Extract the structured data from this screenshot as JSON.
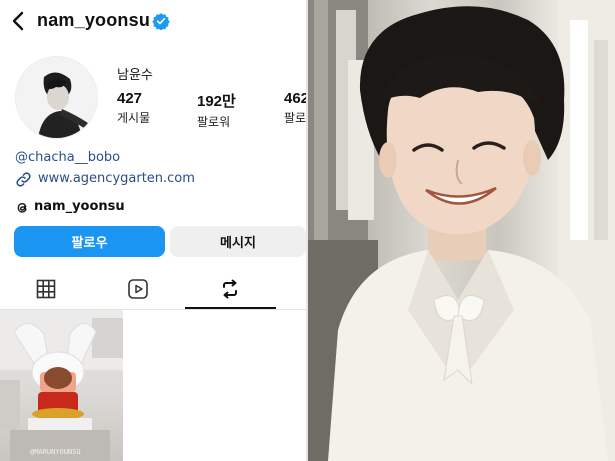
{
  "header": {
    "username": "nam_yoonsu"
  },
  "profile": {
    "display_name": "남윤수",
    "stats": [
      {
        "value": "427",
        "label": "게시물"
      },
      {
        "value": "192만",
        "label": "팔로워"
      },
      {
        "value": "462",
        "label": "팔로"
      }
    ],
    "mention": "@chacha__bobo",
    "website": "www.agencygarten.com",
    "threads_handle": "nam_yoonsu"
  },
  "actions": {
    "follow_label": "팔로우",
    "message_label": "메시지"
  },
  "tabs": [
    {
      "icon": "grid-icon",
      "active": false
    },
    {
      "icon": "reels-icon",
      "active": false
    },
    {
      "icon": "reposts-icon",
      "active": true
    }
  ],
  "post": {
    "watermark": "@MARUNYOUNSU"
  },
  "colors": {
    "follow_button": "#1b95f2",
    "link": "#2b4d8a",
    "verified": "#1d9bf0",
    "message_button": "#efefef"
  }
}
